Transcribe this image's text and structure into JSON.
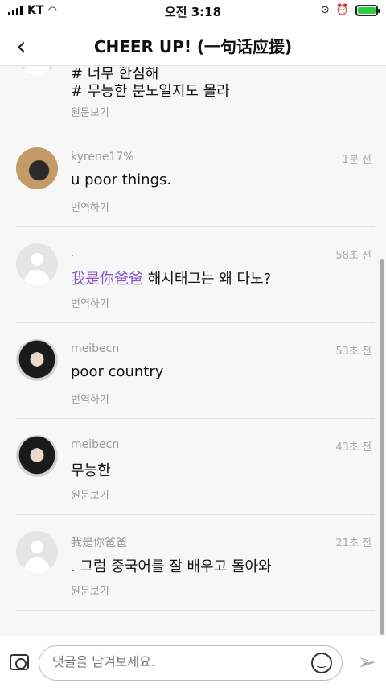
{
  "status": {
    "carrier": "KT",
    "time": "오전 3:18"
  },
  "nav": {
    "back_icon": "‹",
    "title": "CHEER UP! (一句话应援)"
  },
  "comments": [
    {
      "partial": true,
      "line1": "# 너무 한심해",
      "line2": "# 무능한 분노일지도 몰라",
      "action": "원문보기"
    },
    {
      "user": "kyrene17%",
      "time": "1분 전",
      "text": "u poor things.",
      "action": "번역하기",
      "avatar": "cat"
    },
    {
      "user": ".",
      "time": "58초 전",
      "mention": "我是你爸爸",
      "text": " 해시태그는 왜 다노?",
      "action": "번역하기",
      "avatar": "default"
    },
    {
      "user": "meibecn",
      "time": "53초 전",
      "text": "poor country",
      "action": "번역하기",
      "avatar": "girl"
    },
    {
      "user": "meibecn",
      "time": "43초 전",
      "text": "무능한",
      "action": "원문보기",
      "avatar": "girl"
    },
    {
      "user": "我是你爸爸",
      "time": "21초 전",
      "mention": ".",
      "text": " 그럼 중국어를 잘 배우고 돌아와",
      "action": "원문보기",
      "avatar": "default"
    }
  ],
  "input": {
    "placeholder": "댓글을 남겨보세요."
  },
  "icons": {
    "camera": "camera-icon",
    "emoji": "smiley-icon",
    "send": "send-icon"
  }
}
